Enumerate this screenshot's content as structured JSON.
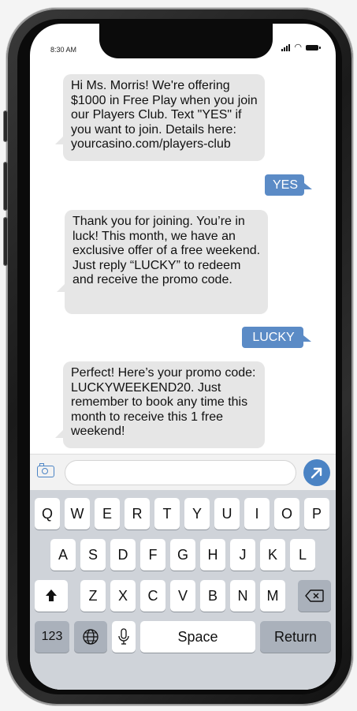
{
  "status_bar": {
    "time": "8:30 AM"
  },
  "messages": [
    {
      "direction": "incoming",
      "text": "Hi Ms. Morris! We're offering $1000 in Free Play when you join our Players Club. Text \"YES\" if you want to join. Details here: yourcasino.com/players-club"
    },
    {
      "direction": "outgoing",
      "text": "YES"
    },
    {
      "direction": "incoming",
      "text": "Thank you for joining. You’re in luck! This month, we have an exclusive offer of a free weekend. Just reply “LUCKY” to redeem and receive the promo code."
    },
    {
      "direction": "outgoing",
      "text": "LUCKY"
    },
    {
      "direction": "incoming",
      "text": "Perfect! Here’s your promo code:  LUCKYWEEKEND20. Just remember to book any time this month to receive this 1 free weekend!"
    }
  ],
  "composer": {
    "value": "",
    "placeholder": ""
  },
  "icons": {
    "camera": "camera-icon",
    "send": "arrow-up-right-icon",
    "shift": "shift-arrow-icon",
    "backspace": "backspace-icon",
    "globe": "globe-icon",
    "mic": "microphone-icon"
  },
  "colors": {
    "accent": "#4a83c4",
    "outgoing_bubble": "#5b8bc6",
    "incoming_bubble": "#e6e6e6"
  },
  "keyboard": {
    "row1": [
      "Q",
      "W",
      "E",
      "R",
      "T",
      "Y",
      "U",
      "I",
      "O",
      "P"
    ],
    "row2": [
      "A",
      "S",
      "D",
      "F",
      "G",
      "H",
      "J",
      "K",
      "L"
    ],
    "row3": [
      "Z",
      "X",
      "C",
      "V",
      "B",
      "N",
      "M"
    ],
    "numbers_label": "123",
    "space_label": "Space",
    "return_label": "Return"
  }
}
